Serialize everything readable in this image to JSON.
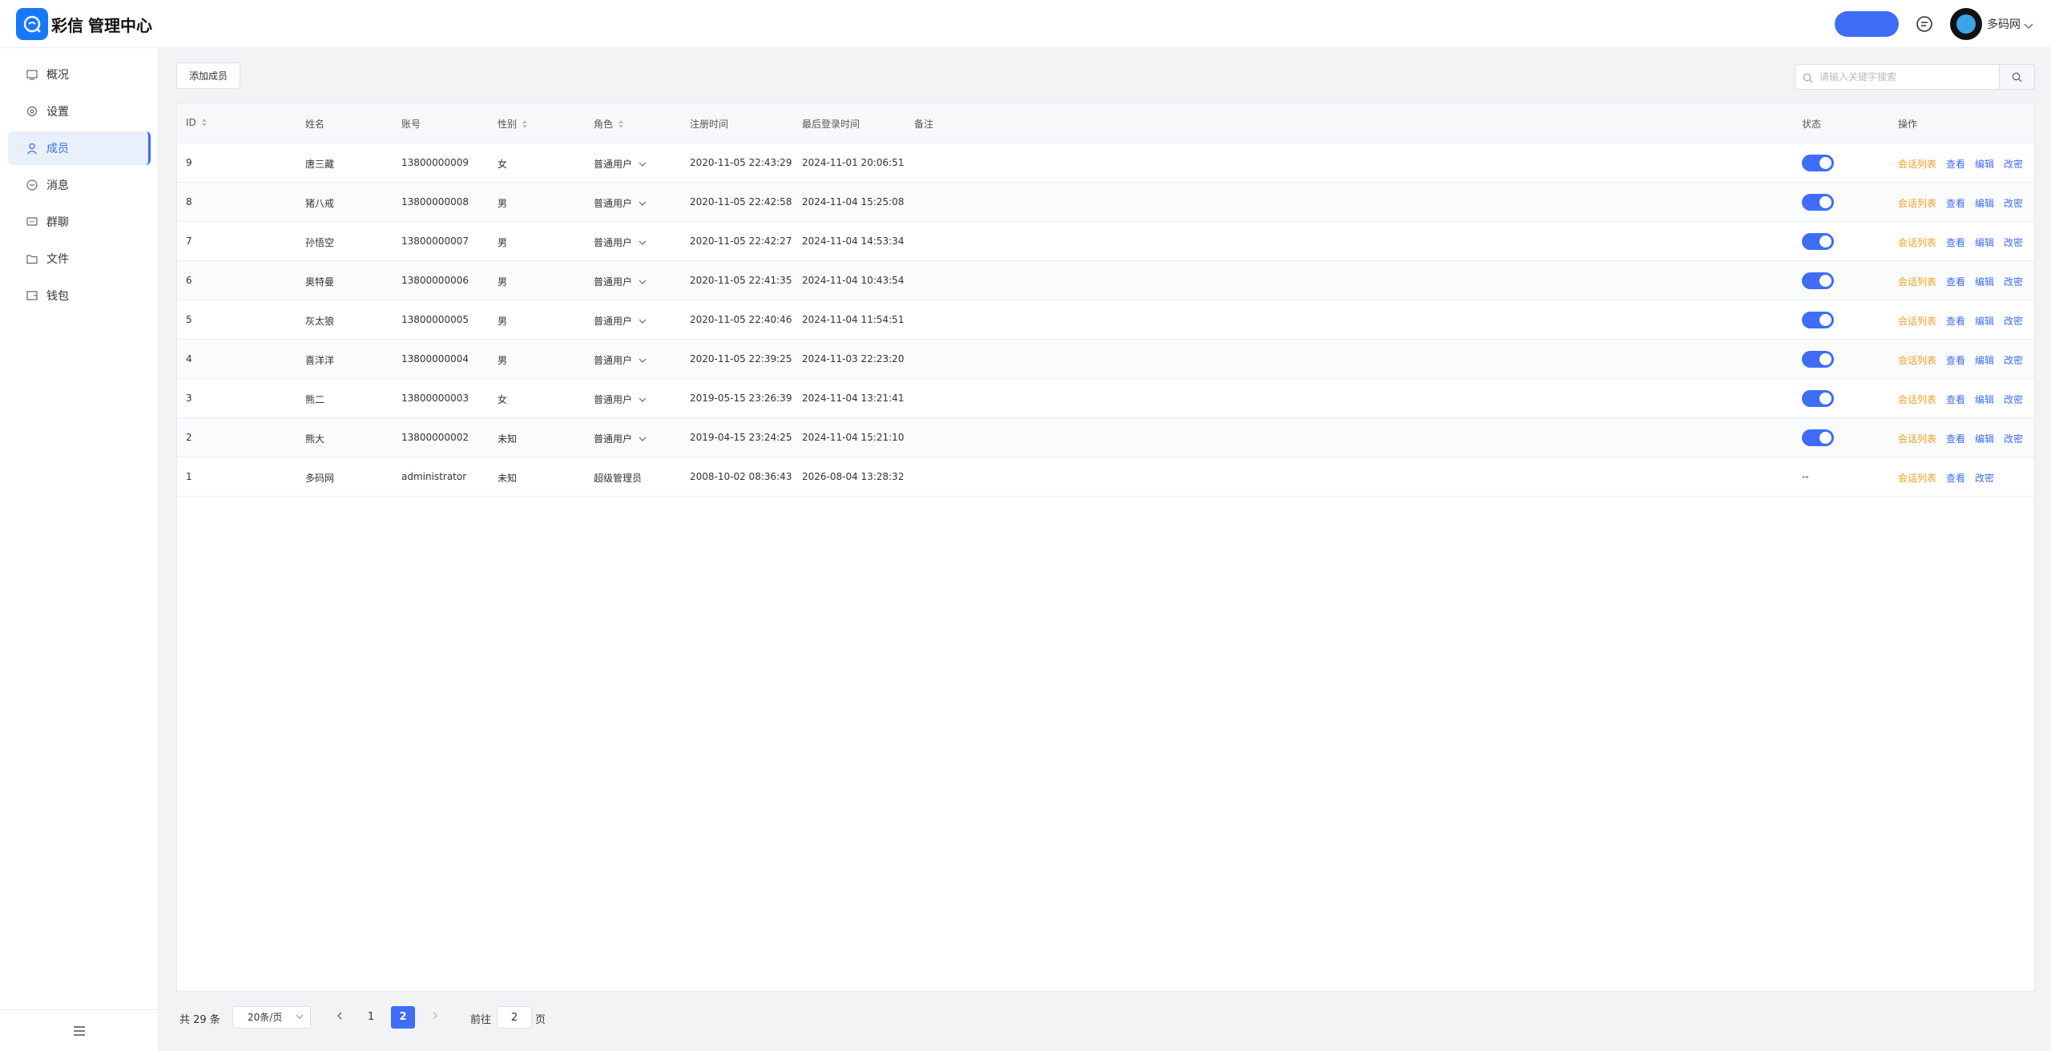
{
  "app": {
    "brand": "彩信",
    "title": "管理中心"
  },
  "header": {
    "user_name": "多码网"
  },
  "sidebar": {
    "items": [
      {
        "label": "概况",
        "icon": "dashboard-icon",
        "active": false
      },
      {
        "label": "设置",
        "icon": "gear-icon",
        "active": false
      },
      {
        "label": "成员",
        "icon": "user-icon",
        "active": true
      },
      {
        "label": "消息",
        "icon": "chat-bubble-icon",
        "active": false
      },
      {
        "label": "群聊",
        "icon": "group-chat-icon",
        "active": false
      },
      {
        "label": "文件",
        "icon": "folder-icon",
        "active": false
      },
      {
        "label": "钱包",
        "icon": "wallet-icon",
        "active": false
      }
    ]
  },
  "toolbar": {
    "add_label": "添加成员",
    "search_placeholder": "请输入关键字搜索"
  },
  "table": {
    "headers": {
      "id": "ID",
      "name": "姓名",
      "account": "账号",
      "gender": "性别",
      "role": "角色",
      "registered": "注册时间",
      "last_login": "最后登录时间",
      "remark": "备注",
      "status": "状态",
      "actions": "操作"
    },
    "rows": [
      {
        "id": "9",
        "name": "唐三藏",
        "account": "13800000009",
        "gender": "女",
        "role": "普通用户",
        "role_dropdown": true,
        "registered": "2020-11-05 22:43:29",
        "last_login": "2024-11-01 20:06:51",
        "remark": "",
        "status_on": true
      },
      {
        "id": "8",
        "name": "猪八戒",
        "account": "13800000008",
        "gender": "男",
        "role": "普通用户",
        "role_dropdown": true,
        "registered": "2020-11-05 22:42:58",
        "last_login": "2024-11-04 15:25:08",
        "remark": "",
        "status_on": true
      },
      {
        "id": "7",
        "name": "孙悟空",
        "account": "13800000007",
        "gender": "男",
        "role": "普通用户",
        "role_dropdown": true,
        "registered": "2020-11-05 22:42:27",
        "last_login": "2024-11-04 14:53:34",
        "remark": "",
        "status_on": true
      },
      {
        "id": "6",
        "name": "奥特曼",
        "account": "13800000006",
        "gender": "男",
        "role": "普通用户",
        "role_dropdown": true,
        "registered": "2020-11-05 22:41:35",
        "last_login": "2024-11-04 10:43:54",
        "remark": "",
        "status_on": true
      },
      {
        "id": "5",
        "name": "灰太狼",
        "account": "13800000005",
        "gender": "男",
        "role": "普通用户",
        "role_dropdown": true,
        "registered": "2020-11-05 22:40:46",
        "last_login": "2024-11-04 11:54:51",
        "remark": "",
        "status_on": true
      },
      {
        "id": "4",
        "name": "喜洋洋",
        "account": "13800000004",
        "gender": "男",
        "role": "普通用户",
        "role_dropdown": true,
        "registered": "2020-11-05 22:39:25",
        "last_login": "2024-11-03 22:23:20",
        "remark": "",
        "status_on": true
      },
      {
        "id": "3",
        "name": "熊二",
        "account": "13800000003",
        "gender": "女",
        "role": "普通用户",
        "role_dropdown": true,
        "registered": "2019-05-15 23:26:39",
        "last_login": "2024-11-04 13:21:41",
        "remark": "",
        "status_on": true
      },
      {
        "id": "2",
        "name": "熊大",
        "account": "13800000002",
        "gender": "未知",
        "role": "普通用户",
        "role_dropdown": true,
        "registered": "2019-04-15 23:24:25",
        "last_login": "2024-11-04 15:21:10",
        "remark": "",
        "status_on": true
      },
      {
        "id": "1",
        "name": "多码网",
        "account": "administrator",
        "gender": "未知",
        "role": "超级管理员",
        "role_dropdown": false,
        "registered": "2008-10-02 08:36:43",
        "last_login": "2026-08-04 13:28:32",
        "remark": "",
        "status_on": null,
        "status_text": "--"
      }
    ],
    "actions": {
      "sessions": "会话列表",
      "view": "查看",
      "edit": "编辑",
      "password": "改密"
    }
  },
  "pagination": {
    "total_text": "共 29 条",
    "page_size": "20条/页",
    "pages": [
      "1",
      "2"
    ],
    "current_page": "2",
    "goto_prefix": "前往",
    "goto_value": "2",
    "goto_suffix": "页"
  },
  "colors": {
    "accent": "#3f6df5",
    "action_orange": "#f0a020",
    "logo": "#1677ff"
  }
}
